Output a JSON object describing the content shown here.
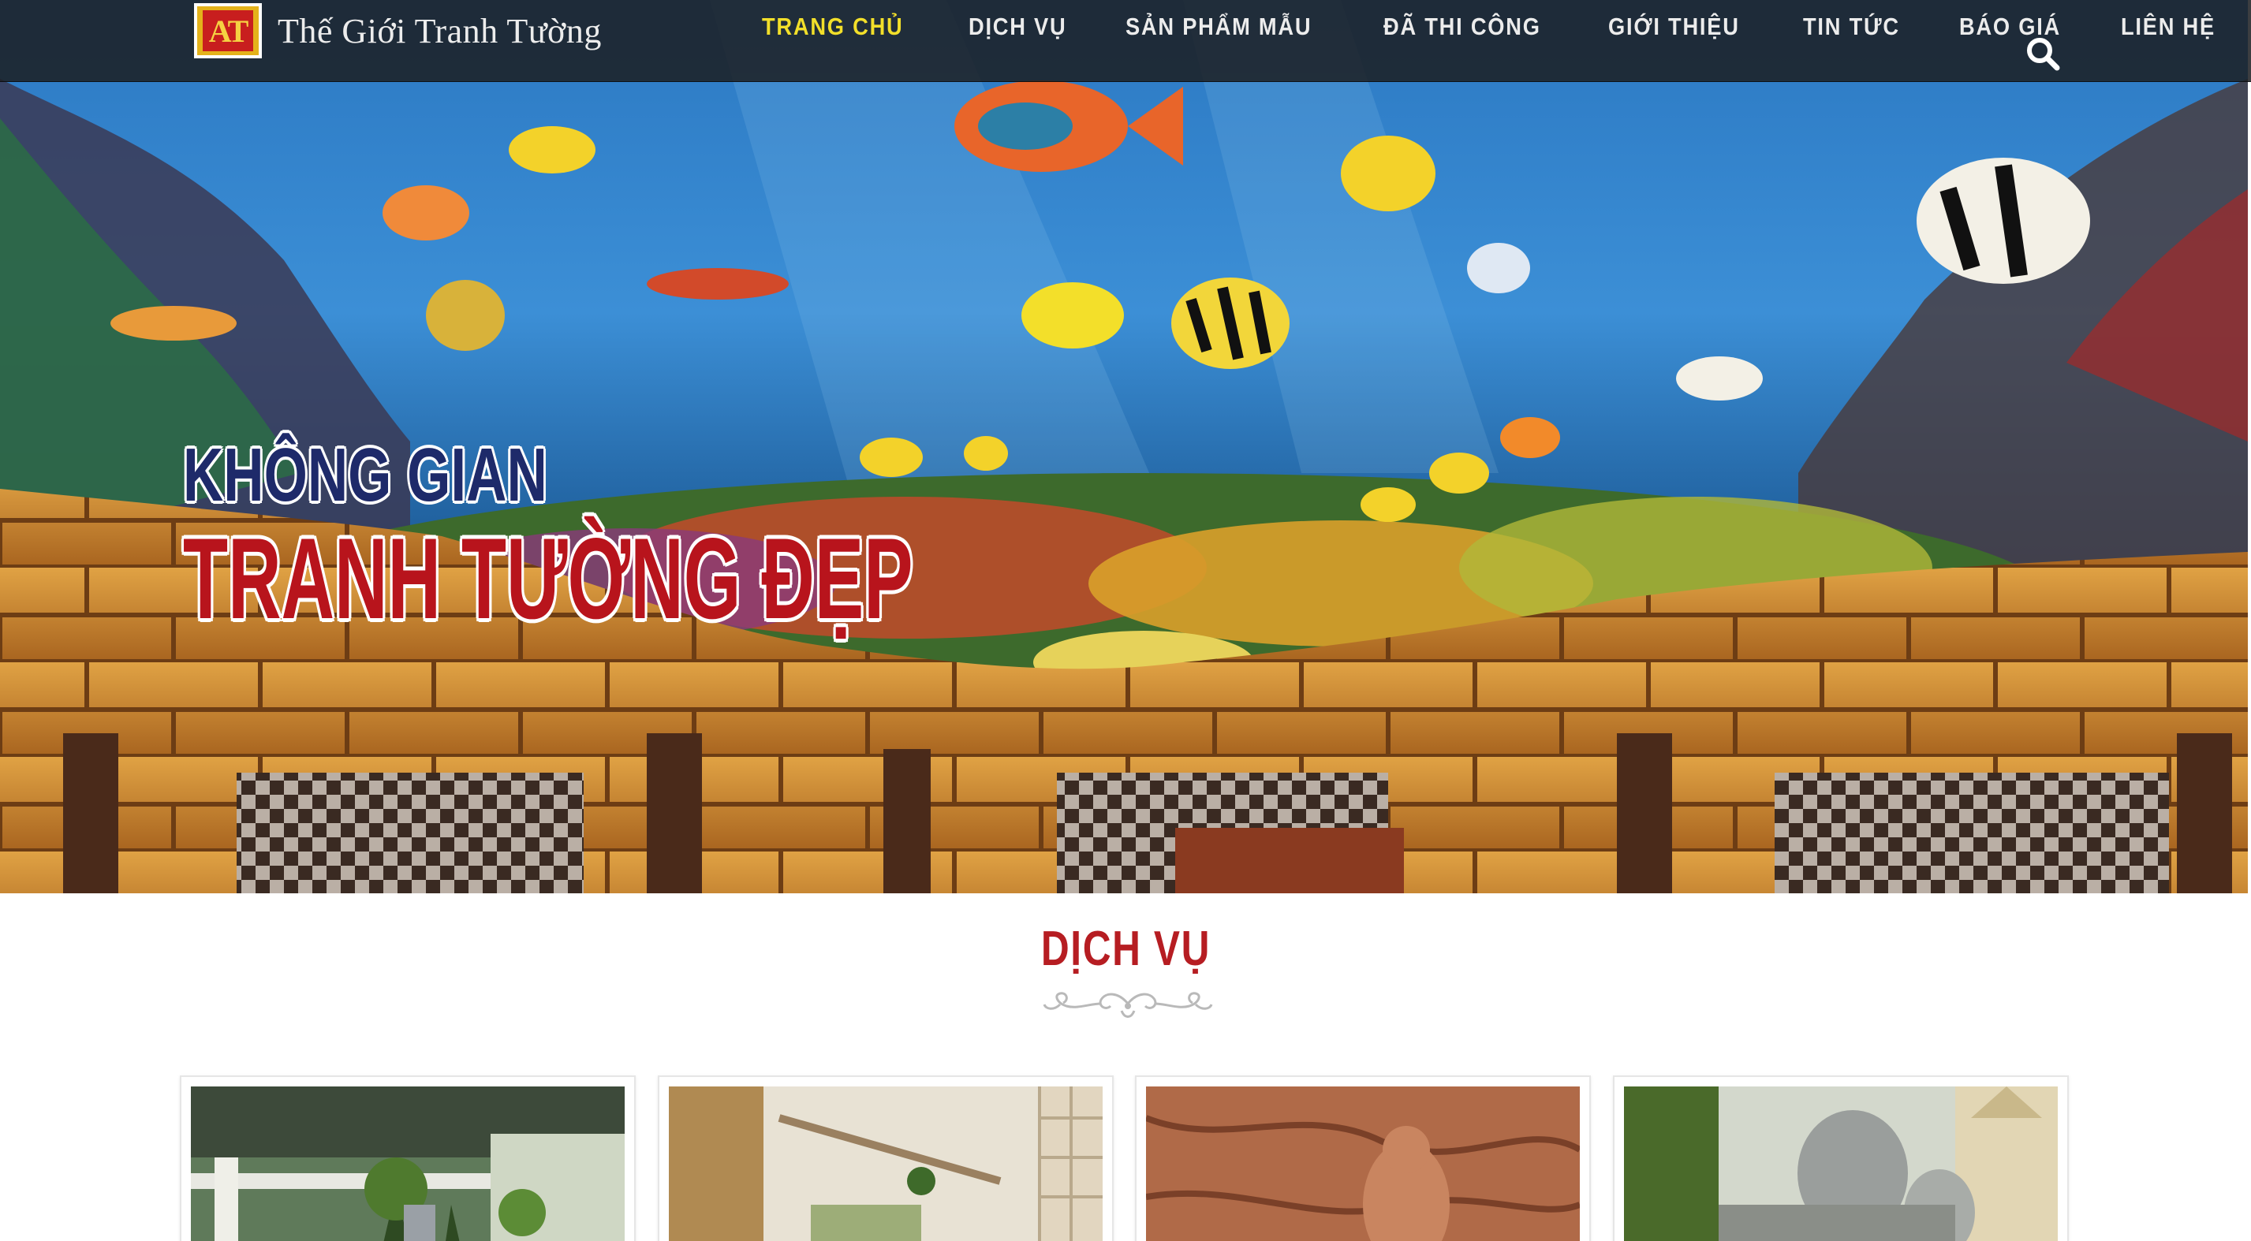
{
  "header": {
    "logo_mark": "AT",
    "logo_text": "Thế Giới Tranh Tường",
    "nav": [
      {
        "label": "TRANG CHỦ",
        "active": true
      },
      {
        "label": "DỊCH VỤ",
        "active": false
      },
      {
        "label": "SẢN PHẨM MẪU",
        "active": false
      },
      {
        "label": "ĐÃ THI CÔNG",
        "active": false
      },
      {
        "label": "GIỚI THIỆU",
        "active": false
      },
      {
        "label": "TIN TỨC",
        "active": false
      },
      {
        "label": "BÁO GIÁ",
        "active": false
      },
      {
        "label": "LIÊN HỆ",
        "active": false
      }
    ],
    "search_icon": "search-icon"
  },
  "hero": {
    "line1": "KHÔNG GIAN",
    "line2": "TRANH TƯỜNG ĐẸP",
    "image_subject": "underwater reef mural above restaurant tables"
  },
  "services": {
    "title": "DỊCH VỤ",
    "cards": [
      {
        "image_subject": "garden with palm trees"
      },
      {
        "image_subject": "stairway with stone wall"
      },
      {
        "image_subject": "bronze relief sculpture"
      },
      {
        "image_subject": "rock garden with gate"
      }
    ]
  },
  "colors": {
    "nav_active": "#f2df2a",
    "nav_text": "#ececec",
    "header_bg": "#1c1e22",
    "headline_blue": "#1e2a6a",
    "headline_red": "#b8141c",
    "section_title": "#b61d22"
  }
}
